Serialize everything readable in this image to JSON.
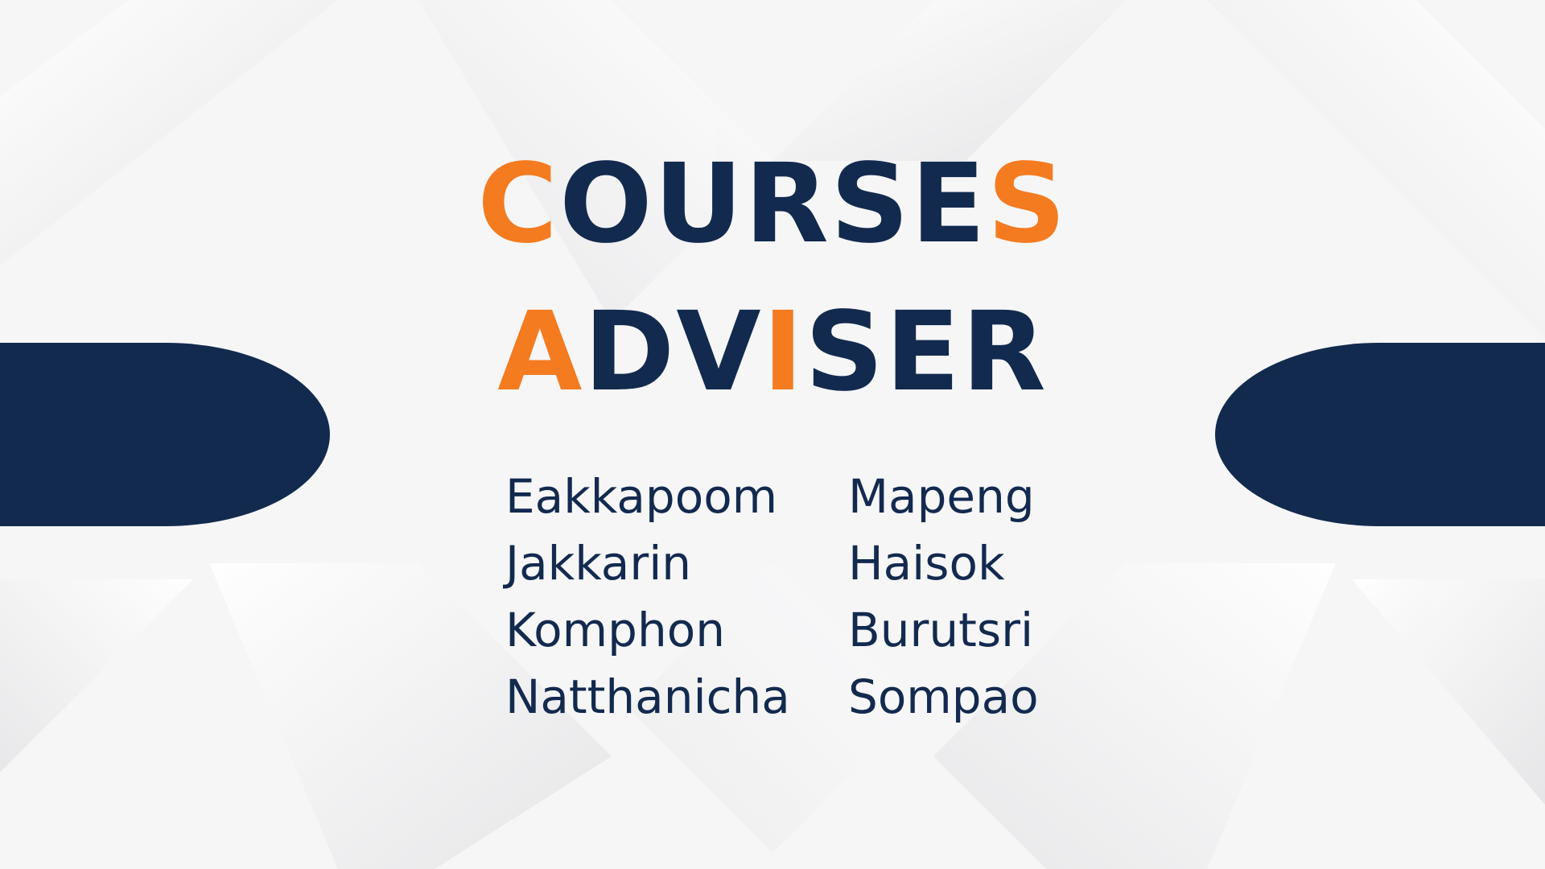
{
  "title": {
    "line1": {
      "first": "C",
      "middle": "OURSE",
      "last": "S"
    },
    "line2": {
      "a": "A",
      "dv": "DV",
      "i": "I",
      "ser": "SER"
    }
  },
  "advisers": {
    "column1": [
      "Eakkapoom",
      "Jakkarin",
      "Komphon",
      "Natthanicha"
    ],
    "column2": [
      "Mapeng",
      "Haisok",
      "Burutsri",
      "Sompao"
    ]
  },
  "colors": {
    "navy": "#132a4f",
    "orange": "#f47b20",
    "background": "#f6f6f7"
  }
}
